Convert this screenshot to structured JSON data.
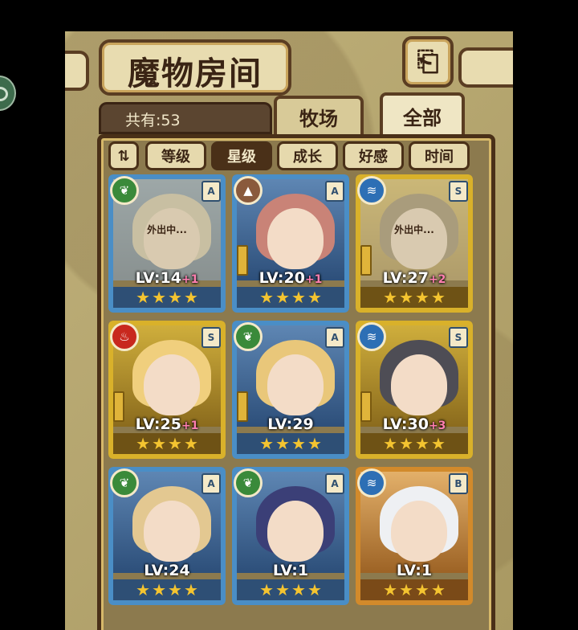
{
  "title": "魔物房间",
  "back_icon": "back-arrow-icon",
  "count_label": "共有:53",
  "tabs": [
    {
      "label": "牧场",
      "active": false
    },
    {
      "label": "全部",
      "active": true
    }
  ],
  "sort_toggle_icon": "sort-order-icon",
  "filters": [
    {
      "label": "等级",
      "active": false
    },
    {
      "label": "星级",
      "active": true
    },
    {
      "label": "成长",
      "active": false
    },
    {
      "label": "好感",
      "active": false
    },
    {
      "label": "时间",
      "active": false
    }
  ],
  "monsters": [
    {
      "element": "leaf",
      "rank": "A",
      "frame": "blue",
      "level": "LV:14",
      "bonus": "+1",
      "away_text": "外出中...",
      "stars": 4,
      "hair": "#c9c1a5"
    },
    {
      "element": "earth",
      "rank": "A",
      "frame": "blue",
      "level": "LV:20",
      "bonus": "+1",
      "away_text": "",
      "stars": 4,
      "hair": "#c98377"
    },
    {
      "element": "water",
      "rank": "S",
      "frame": "gold",
      "level": "LV:27",
      "bonus": "+2",
      "away_text": "外出中...",
      "stars": 4,
      "hair": "#7a6a48"
    },
    {
      "element": "fire",
      "rank": "S",
      "frame": "gold",
      "level": "LV:25",
      "bonus": "+1",
      "away_text": "",
      "stars": 4,
      "hair": "#f0cf7d"
    },
    {
      "element": "leaf",
      "rank": "A",
      "frame": "blue",
      "level": "LV:29",
      "bonus": "",
      "away_text": "",
      "stars": 4,
      "hair": "#e9c77a"
    },
    {
      "element": "water",
      "rank": "S",
      "frame": "gold",
      "level": "LV:30",
      "bonus": "+3",
      "away_text": "",
      "stars": 4,
      "hair": "#4e4d55"
    },
    {
      "element": "leaf",
      "rank": "A",
      "frame": "blue",
      "level": "LV:24",
      "bonus": "",
      "away_text": "",
      "stars": 4,
      "hair": "#e3c891"
    },
    {
      "element": "leaf",
      "rank": "A",
      "frame": "blue",
      "level": "LV:1",
      "bonus": "",
      "away_text": "",
      "stars": 4,
      "hair": "#3b3f77"
    },
    {
      "element": "water",
      "rank": "B",
      "frame": "orange",
      "level": "LV:1",
      "bonus": "",
      "away_text": "",
      "stars": 4,
      "hair": "#eef0f3"
    }
  ],
  "element_colors": {
    "leaf": "#3a8a3a",
    "earth": "#8a5a3c",
    "water": "#2d6fb5",
    "fire": "#c8281e"
  },
  "element_glyphs": {
    "leaf": "❦",
    "earth": "▲",
    "water": "≋",
    "fire": "♨"
  }
}
